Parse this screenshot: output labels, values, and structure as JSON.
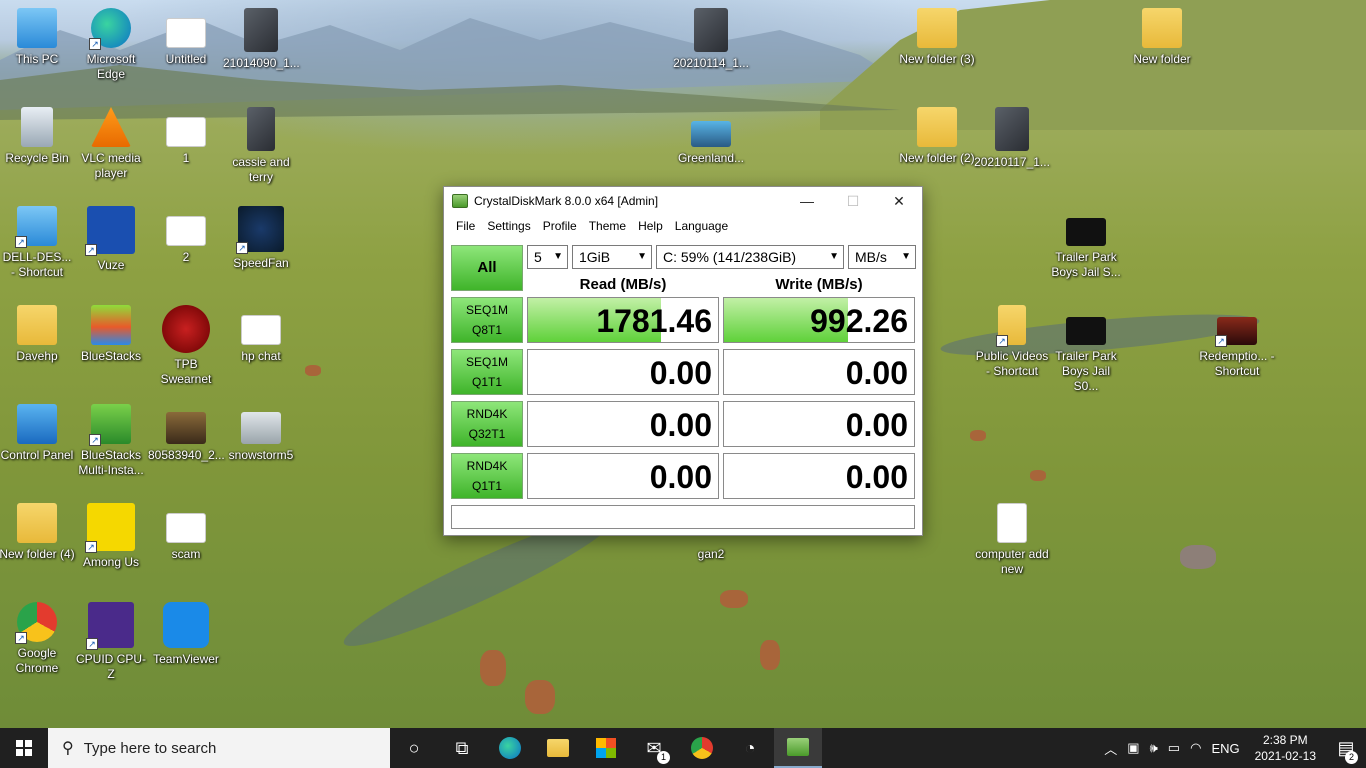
{
  "desktop": {
    "icons": [
      {
        "label": "This PC"
      },
      {
        "label": "Microsoft Edge"
      },
      {
        "label": "Untitled"
      },
      {
        "label": "21014090_1..."
      },
      {
        "label": "20210114_1..."
      },
      {
        "label": "New folder (3)"
      },
      {
        "label": "New folder"
      },
      {
        "label": "Recycle Bin"
      },
      {
        "label": "VLC media player"
      },
      {
        "label": "1"
      },
      {
        "label": "cassie and terry"
      },
      {
        "label": "Greenland..."
      },
      {
        "label": "New folder (2)"
      },
      {
        "label": "20210117_1..."
      },
      {
        "label": "DELL-DES... - Shortcut"
      },
      {
        "label": "Vuze"
      },
      {
        "label": "2"
      },
      {
        "label": "SpeedFan"
      },
      {
        "label": "Trailer Park Boys Jail S..."
      },
      {
        "label": "Davehp"
      },
      {
        "label": "BlueStacks"
      },
      {
        "label": "TPB Swearnet"
      },
      {
        "label": "hp chat"
      },
      {
        "label": "Public Videos - Shortcut"
      },
      {
        "label": "Trailer Park Boys Jail S0..."
      },
      {
        "label": "Redemptio... - Shortcut"
      },
      {
        "label": "Control Panel"
      },
      {
        "label": "BlueStacks Multi-Insta..."
      },
      {
        "label": "80583940_2..."
      },
      {
        "label": "snowstorm5"
      },
      {
        "label": "New folder (4)"
      },
      {
        "label": "Among Us"
      },
      {
        "label": "scam"
      },
      {
        "label": "gan2"
      },
      {
        "label": "computer add new"
      },
      {
        "label": "Google Chrome"
      },
      {
        "label": "CPUID CPU-Z"
      },
      {
        "label": "TeamViewer"
      }
    ]
  },
  "cdm": {
    "title": "CrystalDiskMark 8.0.0 x64 [Admin]",
    "minimize": "—",
    "maximize": "☐",
    "close": "✕",
    "menu": [
      "File",
      "Settings",
      "Profile",
      "Theme",
      "Help",
      "Language"
    ],
    "all_button": "All",
    "count": "5",
    "size": "1GiB",
    "drive": "C: 59% (141/238GiB)",
    "unit": "MB/s",
    "read_header": "Read (MB/s)",
    "write_header": "Write (MB/s)",
    "tests": [
      {
        "line1": "SEQ1M",
        "line2": "Q8T1",
        "read": "1781.46",
        "write": "992.26",
        "read_fill": 0.7,
        "write_fill": 0.65
      },
      {
        "line1": "SEQ1M",
        "line2": "Q1T1",
        "read": "0.00",
        "write": "0.00",
        "read_fill": 0,
        "write_fill": 0
      },
      {
        "line1": "RND4K",
        "line2": "Q32T1",
        "read": "0.00",
        "write": "0.00",
        "read_fill": 0,
        "write_fill": 0
      },
      {
        "line1": "RND4K",
        "line2": "Q1T1",
        "read": "0.00",
        "write": "0.00",
        "read_fill": 0,
        "write_fill": 0
      }
    ],
    "status": ""
  },
  "taskbar": {
    "search_placeholder": "Type here to search",
    "mail_badge": "1",
    "language": "ENG",
    "time": "2:38 PM",
    "date": "2021-02-13",
    "notification_count": "2"
  }
}
